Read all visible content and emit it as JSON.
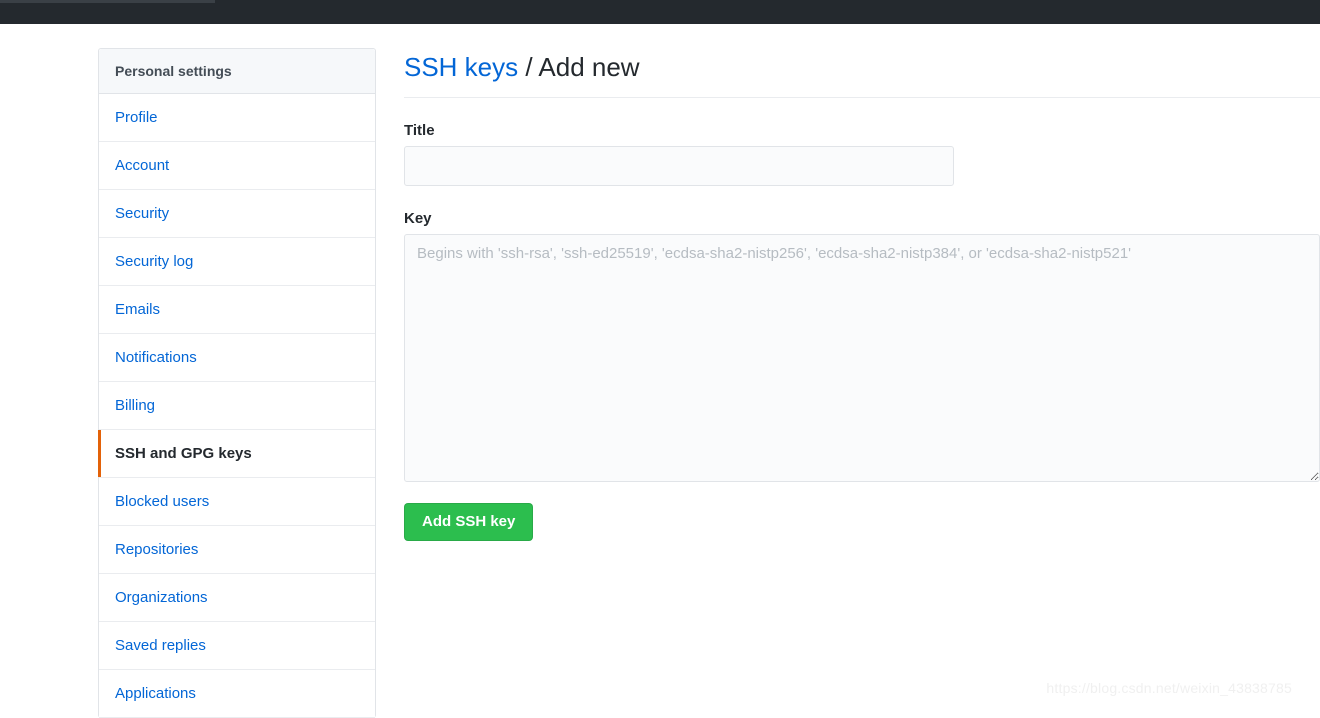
{
  "topbar": {
    "progress_label": "page-load-progress"
  },
  "sidebar": {
    "header": "Personal settings",
    "items": [
      {
        "label": "Profile",
        "active": false
      },
      {
        "label": "Account",
        "active": false
      },
      {
        "label": "Security",
        "active": false
      },
      {
        "label": "Security log",
        "active": false
      },
      {
        "label": "Emails",
        "active": false
      },
      {
        "label": "Notifications",
        "active": false
      },
      {
        "label": "Billing",
        "active": false
      },
      {
        "label": "SSH and GPG keys",
        "active": true
      },
      {
        "label": "Blocked users",
        "active": false
      },
      {
        "label": "Repositories",
        "active": false
      },
      {
        "label": "Organizations",
        "active": false
      },
      {
        "label": "Saved replies",
        "active": false
      },
      {
        "label": "Applications",
        "active": false
      }
    ]
  },
  "main": {
    "heading_link": "SSH keys",
    "heading_separator": " / ",
    "heading_current": "Add new",
    "title_label": "Title",
    "title_value": "",
    "title_placeholder": "",
    "key_label": "Key",
    "key_value": "",
    "key_placeholder": "Begins with 'ssh-rsa', 'ssh-ed25519', 'ecdsa-sha2-nistp256', 'ecdsa-sha2-nistp384', or 'ecdsa-sha2-nistp521'",
    "submit_label": "Add SSH key"
  },
  "watermark": {
    "text": "https://blog.csdn.net/weixin_43838785"
  },
  "colors": {
    "topbar_bg": "#24292e",
    "link_blue": "#0366d6",
    "active_marker_orange": "#e36209",
    "button_green": "#2cbe4e",
    "panel_header_bg": "#f6f8fa",
    "border_gray": "#e1e4e8",
    "input_bg": "#fafbfc",
    "text_dark": "#24292e"
  }
}
